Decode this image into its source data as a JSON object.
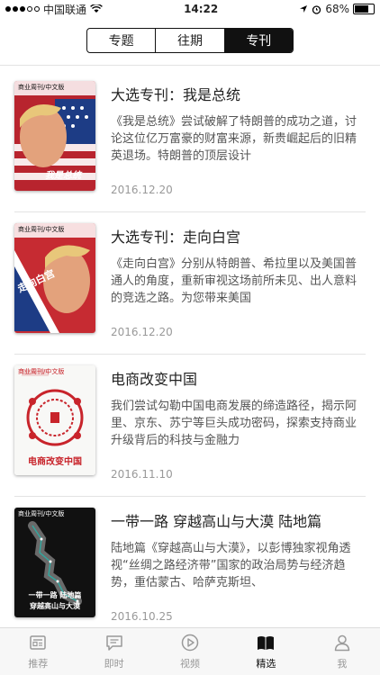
{
  "status": {
    "carrier": "中国联通",
    "time": "14:22",
    "battery": "68%"
  },
  "segments": [
    {
      "label": "专题"
    },
    {
      "label": "往期"
    },
    {
      "label": "专刊"
    }
  ],
  "articles": [
    {
      "title": "大选专刊：我是总统",
      "desc": "《我是总统》尝试破解了特朗普的成功之道，讨论这位亿万富豪的财富来源，新贵崛起后的旧精英退场。特朗普的顶层设计",
      "date": "2016.12.20",
      "cover_brand": "商业周刊/中文版",
      "cover_text": "我是总统"
    },
    {
      "title": "大选专刊：走向白宫",
      "desc": "《走向白宫》分别从特朗普、希拉里以及美国普通人的角度，重新审视这场前所未见、出人意料的竞选之路。为您带来美国",
      "date": "2016.12.20",
      "cover_brand": "商业周刊/中文版",
      "cover_text": "走向白宫"
    },
    {
      "title": "电商改变中国",
      "desc": "我们尝试勾勒中国电商发展的缔造路径，揭示阿里、京东、苏宁等巨头成功密码，探索支持商业升级背后的科技与金融力",
      "date": "2016.11.10",
      "cover_brand": "商业周刊/中文版",
      "cover_text": "电商改变中国"
    },
    {
      "title": "一带一路 穿越高山与大漠 陆地篇",
      "desc": "陆地篇《穿越高山与大漠》，以彭博独家视角透视“丝绸之路经济带”国家的政治局势与经济趋势，重估蒙古、哈萨克斯坦、",
      "date": "2016.10.25",
      "cover_brand": "商业周刊/中文版",
      "cover_text_1": "一带一路 陆地篇",
      "cover_text_2": "穿越高山与大漠"
    }
  ],
  "tabs": [
    {
      "label": "推荐",
      "icon": "news-icon"
    },
    {
      "label": "即时",
      "icon": "chat-icon"
    },
    {
      "label": "视频",
      "icon": "play-icon"
    },
    {
      "label": "精选",
      "icon": "book-icon"
    },
    {
      "label": "我",
      "icon": "person-icon"
    }
  ]
}
